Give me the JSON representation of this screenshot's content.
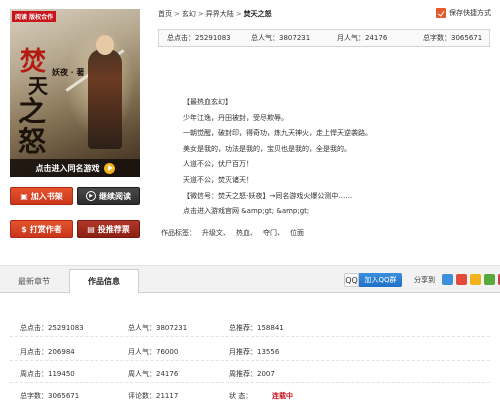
{
  "cover": {
    "brand": "阅读 版权合作",
    "title_chars": [
      "焚",
      "天",
      "之怒"
    ],
    "author_line": "妖夜 · 著",
    "enter_game": "点击进入同名游戏"
  },
  "buttons": {
    "add_shelf": "加入书架",
    "continue_read": "继续阅读",
    "reward": "打赏作者",
    "ticket": "投推荐票"
  },
  "breadcrumb": {
    "items": [
      "首页",
      "玄幻",
      "异界大陆",
      "焚天之怒"
    ],
    "separator": ">"
  },
  "favorite_label": "保存快捷方式",
  "statbar": {
    "total_clicks": "总点击：25291083",
    "total_pop": "总人气：3807231",
    "monthly_pop": "月人气：24176",
    "total_words": "总字数：3065671"
  },
  "description": [
    "【最热血玄幻】",
    "少年江逸，丹田被封，受尽欺辱。",
    "一朝觉醒，破封印，得奇功，炼九天神火，走上悍天逆袭路。",
    "美女是我的，功法是我的，宝贝也是我的，全是我的。",
    "人道不公，伏尸百万！",
    "天道不公，焚灭诸天！",
    "【微信号：焚天之怒-妖夜】→同名游戏火爆公测中……",
    "点击进入游戏官网 &amp;gt; &amp;gt;"
  ],
  "tags": {
    "label": "作品标签：",
    "items": [
      "升级文、",
      "热血、",
      "夺门、",
      "位面"
    ]
  },
  "tabs": {
    "latest": "最新章节",
    "info": "作品信息"
  },
  "qq_group": {
    "icon": "QQ",
    "label": "加入QQ群"
  },
  "share_label": "分享到",
  "share_colors": [
    "#3b8fdb",
    "#e34a3a",
    "#f1b31c",
    "#57a93b",
    "#d13f3f",
    "#3a6fd0"
  ],
  "stats": [
    [
      "总点击：25291083",
      "总人气：3807231",
      "总推荐：158841"
    ],
    [
      "月点击：206984",
      "月人气：76000",
      "月推荐：13556"
    ],
    [
      "周点击：119450",
      "周人气：24176",
      "周推荐：2007"
    ],
    [
      "总字数：3065671",
      "评论数：21117",
      "状 态：",
      "连载中"
    ]
  ]
}
